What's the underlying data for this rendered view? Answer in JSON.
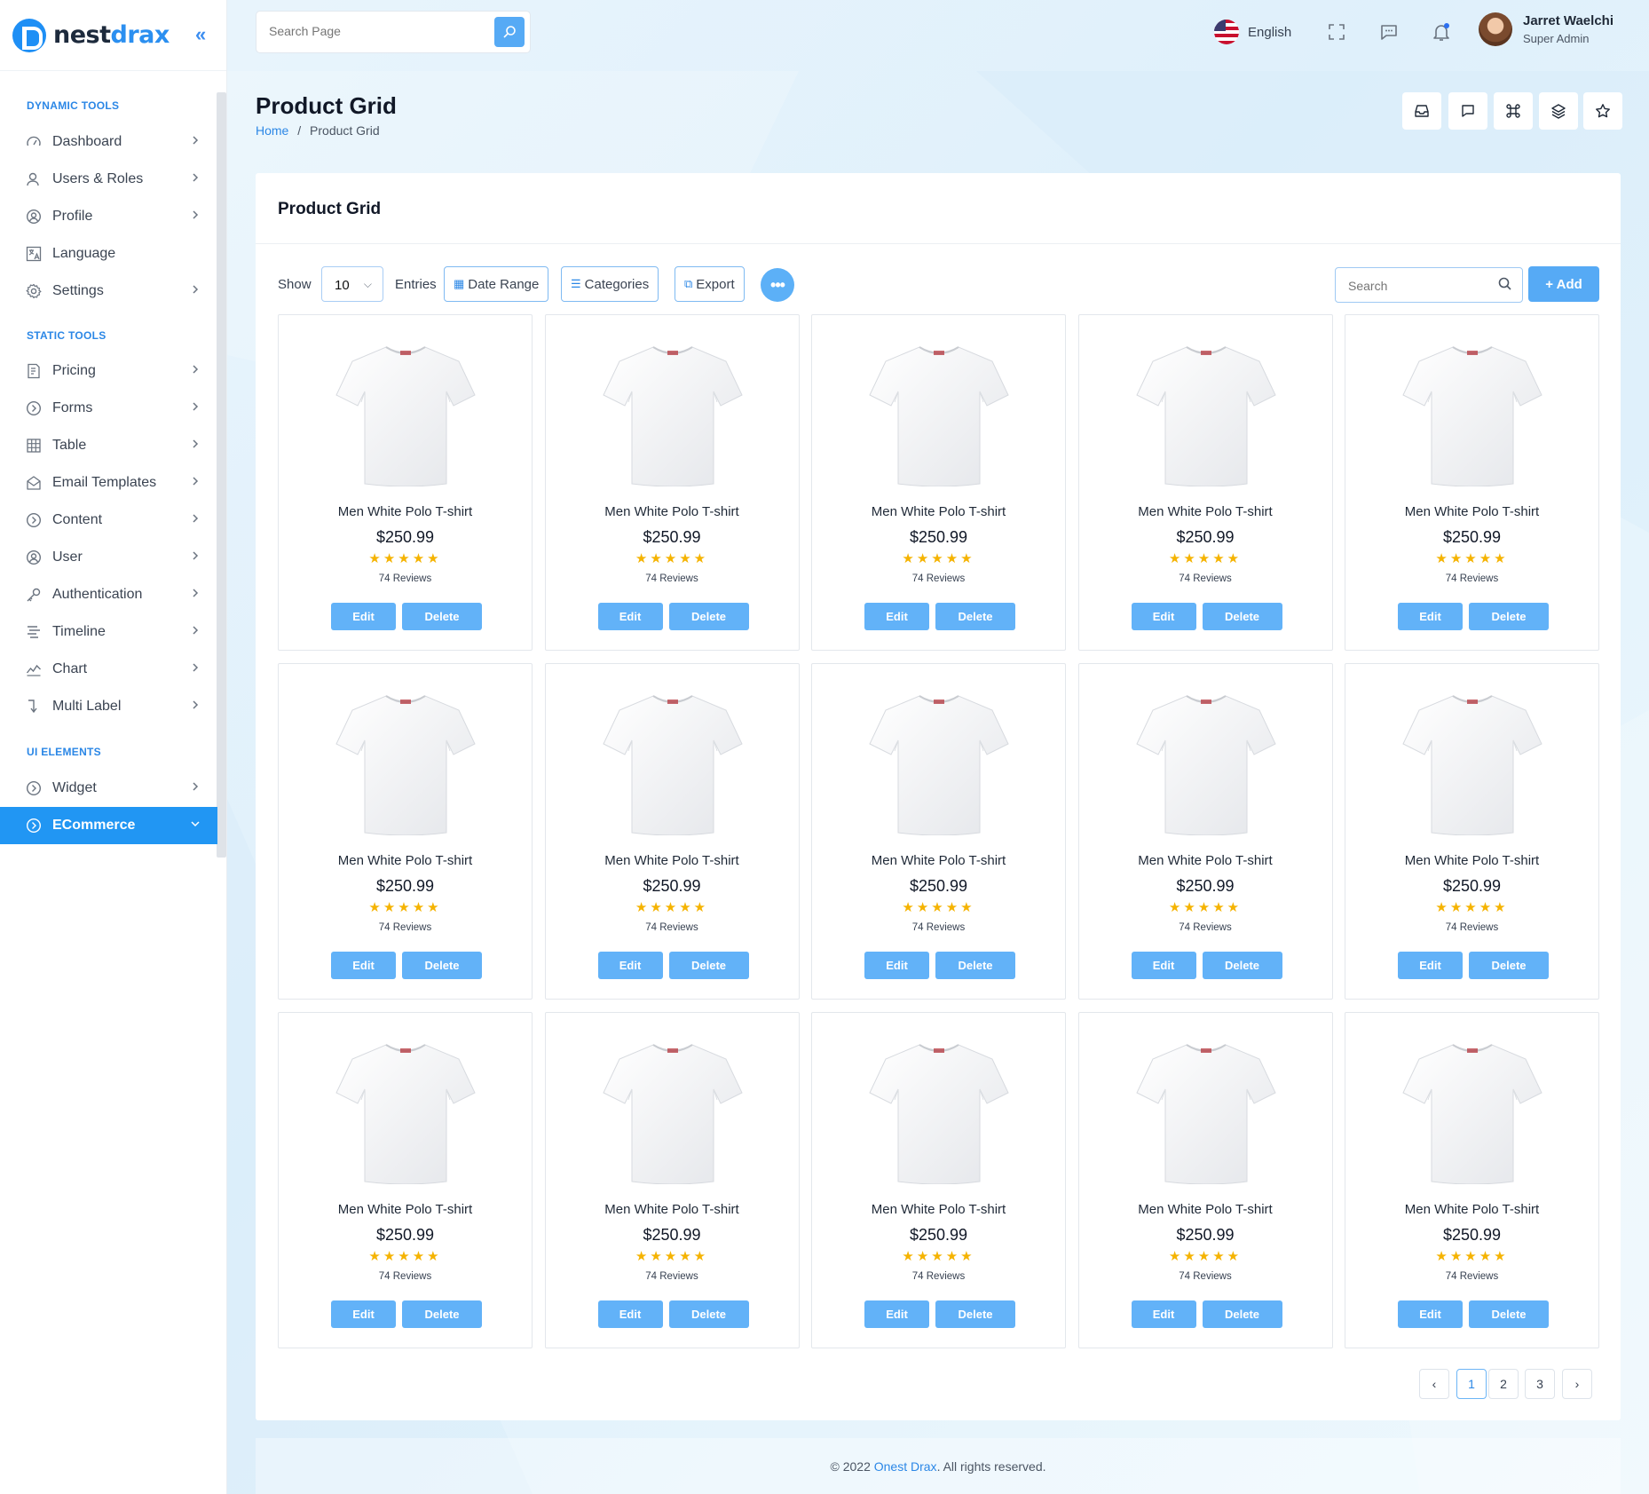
{
  "brand": {
    "name_a": "nest",
    "name_b": "drax"
  },
  "header": {
    "search_placeholder": "Search Page",
    "language": "English",
    "user_name": "Jarret Waelchi",
    "user_role": "Super Admin"
  },
  "sidebar": {
    "sections": [
      "DYNAMIC TOOLS",
      "STATIC TOOLS",
      "UI ELEMENTS"
    ],
    "items": [
      {
        "label": "Dashboard",
        "icon": "gauge-icon"
      },
      {
        "label": "Users & Roles",
        "icon": "user-icon"
      },
      {
        "label": "Profile",
        "icon": "profile-circle-icon"
      },
      {
        "label": "Language",
        "icon": "translate-icon"
      },
      {
        "label": "Settings",
        "icon": "gear-icon"
      },
      {
        "label": "Pricing",
        "icon": "receipt-icon"
      },
      {
        "label": "Forms",
        "icon": "circle-arrow-icon"
      },
      {
        "label": "Table",
        "icon": "grid-icon"
      },
      {
        "label": "Email Templates",
        "icon": "mail-open-icon"
      },
      {
        "label": "Content",
        "icon": "circle-arrow-icon"
      },
      {
        "label": "User",
        "icon": "profile-circle-icon"
      },
      {
        "label": "Authentication",
        "icon": "key-icon"
      },
      {
        "label": "Timeline",
        "icon": "timeline-icon"
      },
      {
        "label": "Chart",
        "icon": "chart-line-icon"
      },
      {
        "label": "Multi Label",
        "icon": "arrow-down-right-icon"
      },
      {
        "label": "Widget",
        "icon": "circle-arrow-icon"
      },
      {
        "label": "ECommerce",
        "icon": "circle-arrow-icon",
        "active": true
      }
    ]
  },
  "page": {
    "title": "Product Grid",
    "breadcrumb_home": "Home",
    "breadcrumb_sep": "/",
    "breadcrumb_current": "Product Grid"
  },
  "card": {
    "title": "Product Grid",
    "show_label": "Show",
    "entries_value": "10",
    "entries_label": "Entries",
    "date_range": "Date Range",
    "categories": "Categories",
    "export": "Export",
    "search_placeholder": "Search",
    "add_label": "+ Add"
  },
  "products": [
    {
      "name": "Men White Polo T-shirt",
      "price": "$250.99",
      "rating": 5,
      "reviews": "74 Reviews"
    },
    {
      "name": "Men White Polo T-shirt",
      "price": "$250.99",
      "rating": 5,
      "reviews": "74 Reviews"
    },
    {
      "name": "Men White Polo T-shirt",
      "price": "$250.99",
      "rating": 5,
      "reviews": "74 Reviews"
    },
    {
      "name": "Men White Polo T-shirt",
      "price": "$250.99",
      "rating": 5,
      "reviews": "74 Reviews"
    },
    {
      "name": "Men White Polo T-shirt",
      "price": "$250.99",
      "rating": 5,
      "reviews": "74 Reviews"
    },
    {
      "name": "Men White Polo T-shirt",
      "price": "$250.99",
      "rating": 5,
      "reviews": "74 Reviews"
    },
    {
      "name": "Men White Polo T-shirt",
      "price": "$250.99",
      "rating": 5,
      "reviews": "74 Reviews"
    },
    {
      "name": "Men White Polo T-shirt",
      "price": "$250.99",
      "rating": 5,
      "reviews": "74 Reviews"
    },
    {
      "name": "Men White Polo T-shirt",
      "price": "$250.99",
      "rating": 5,
      "reviews": "74 Reviews"
    },
    {
      "name": "Men White Polo T-shirt",
      "price": "$250.99",
      "rating": 5,
      "reviews": "74 Reviews"
    },
    {
      "name": "Men White Polo T-shirt",
      "price": "$250.99",
      "rating": 5,
      "reviews": "74 Reviews"
    },
    {
      "name": "Men White Polo T-shirt",
      "price": "$250.99",
      "rating": 5,
      "reviews": "74 Reviews"
    },
    {
      "name": "Men White Polo T-shirt",
      "price": "$250.99",
      "rating": 5,
      "reviews": "74 Reviews"
    },
    {
      "name": "Men White Polo T-shirt",
      "price": "$250.99",
      "rating": 5,
      "reviews": "74 Reviews"
    },
    {
      "name": "Men White Polo T-shirt",
      "price": "$250.99",
      "rating": 5,
      "reviews": "74 Reviews"
    }
  ],
  "product_actions": {
    "edit": "Edit",
    "delete": "Delete"
  },
  "pagination": {
    "prev": "‹",
    "pages": [
      "1",
      "2",
      "3"
    ],
    "current": "1",
    "next": "›"
  },
  "footer": {
    "prefix": "© 2022 ",
    "link": "Onest Drax",
    "suffix": ". All rights reserved."
  },
  "colors": {
    "accent": "#2196f3",
    "button": "#62b2f8",
    "star": "#f5b301"
  }
}
